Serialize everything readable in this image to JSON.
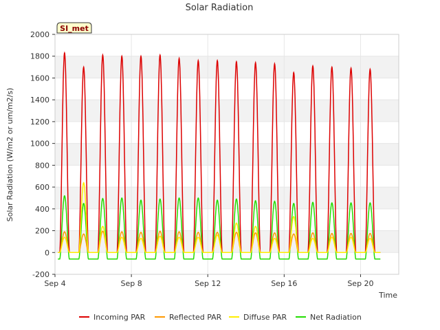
{
  "chart_data": {
    "type": "line",
    "title": "Solar Radiation",
    "xlabel": "Time",
    "ylabel": "Solar Radiation (W/m2 or um/m2/s)",
    "badge": "SI_met",
    "ylim": [
      -200,
      2000
    ],
    "yticks": [
      -200,
      0,
      200,
      400,
      600,
      800,
      1000,
      1200,
      1400,
      1600,
      1800,
      2000
    ],
    "xlim_days": [
      4,
      22
    ],
    "xticks": [
      {
        "day": 4,
        "label": "Sep 4"
      },
      {
        "day": 8,
        "label": "Sep 8"
      },
      {
        "day": 12,
        "label": "Sep 12"
      },
      {
        "day": 16,
        "label": "Sep 16"
      },
      {
        "day": 20,
        "label": "Sep 20"
      }
    ],
    "grid": true,
    "legend_position": "bottom",
    "days": [
      4,
      5,
      6,
      7,
      8,
      9,
      10,
      11,
      12,
      13,
      14,
      15,
      16,
      17,
      18,
      19,
      20
    ],
    "series": [
      {
        "name": "Incoming PAR",
        "color": "#dd0000",
        "daily_peaks": [
          1830,
          1700,
          1810,
          1800,
          1800,
          1810,
          1780,
          1760,
          1760,
          1750,
          1740,
          1730,
          1650,
          1710,
          1700,
          1690,
          1680
        ],
        "night_value": 0
      },
      {
        "name": "Reflected PAR",
        "color": "#ff9900",
        "daily_peaks": [
          190,
          170,
          195,
          190,
          185,
          195,
          190,
          185,
          185,
          185,
          180,
          180,
          170,
          180,
          175,
          175,
          175
        ],
        "night_value": 0
      },
      {
        "name": "Diffuse PAR",
        "color": "#ffee00",
        "daily_peaks": [
          140,
          640,
          240,
          140,
          130,
          150,
          140,
          140,
          160,
          270,
          240,
          130,
          330,
          130,
          140,
          140,
          130
        ],
        "night_value": 0
      },
      {
        "name": "Net Radiation",
        "color": "#22dd00",
        "daily_peaks": [
          520,
          450,
          495,
          500,
          480,
          490,
          500,
          500,
          480,
          490,
          475,
          470,
          450,
          460,
          455,
          455,
          455
        ],
        "night_value": -60
      }
    ]
  }
}
